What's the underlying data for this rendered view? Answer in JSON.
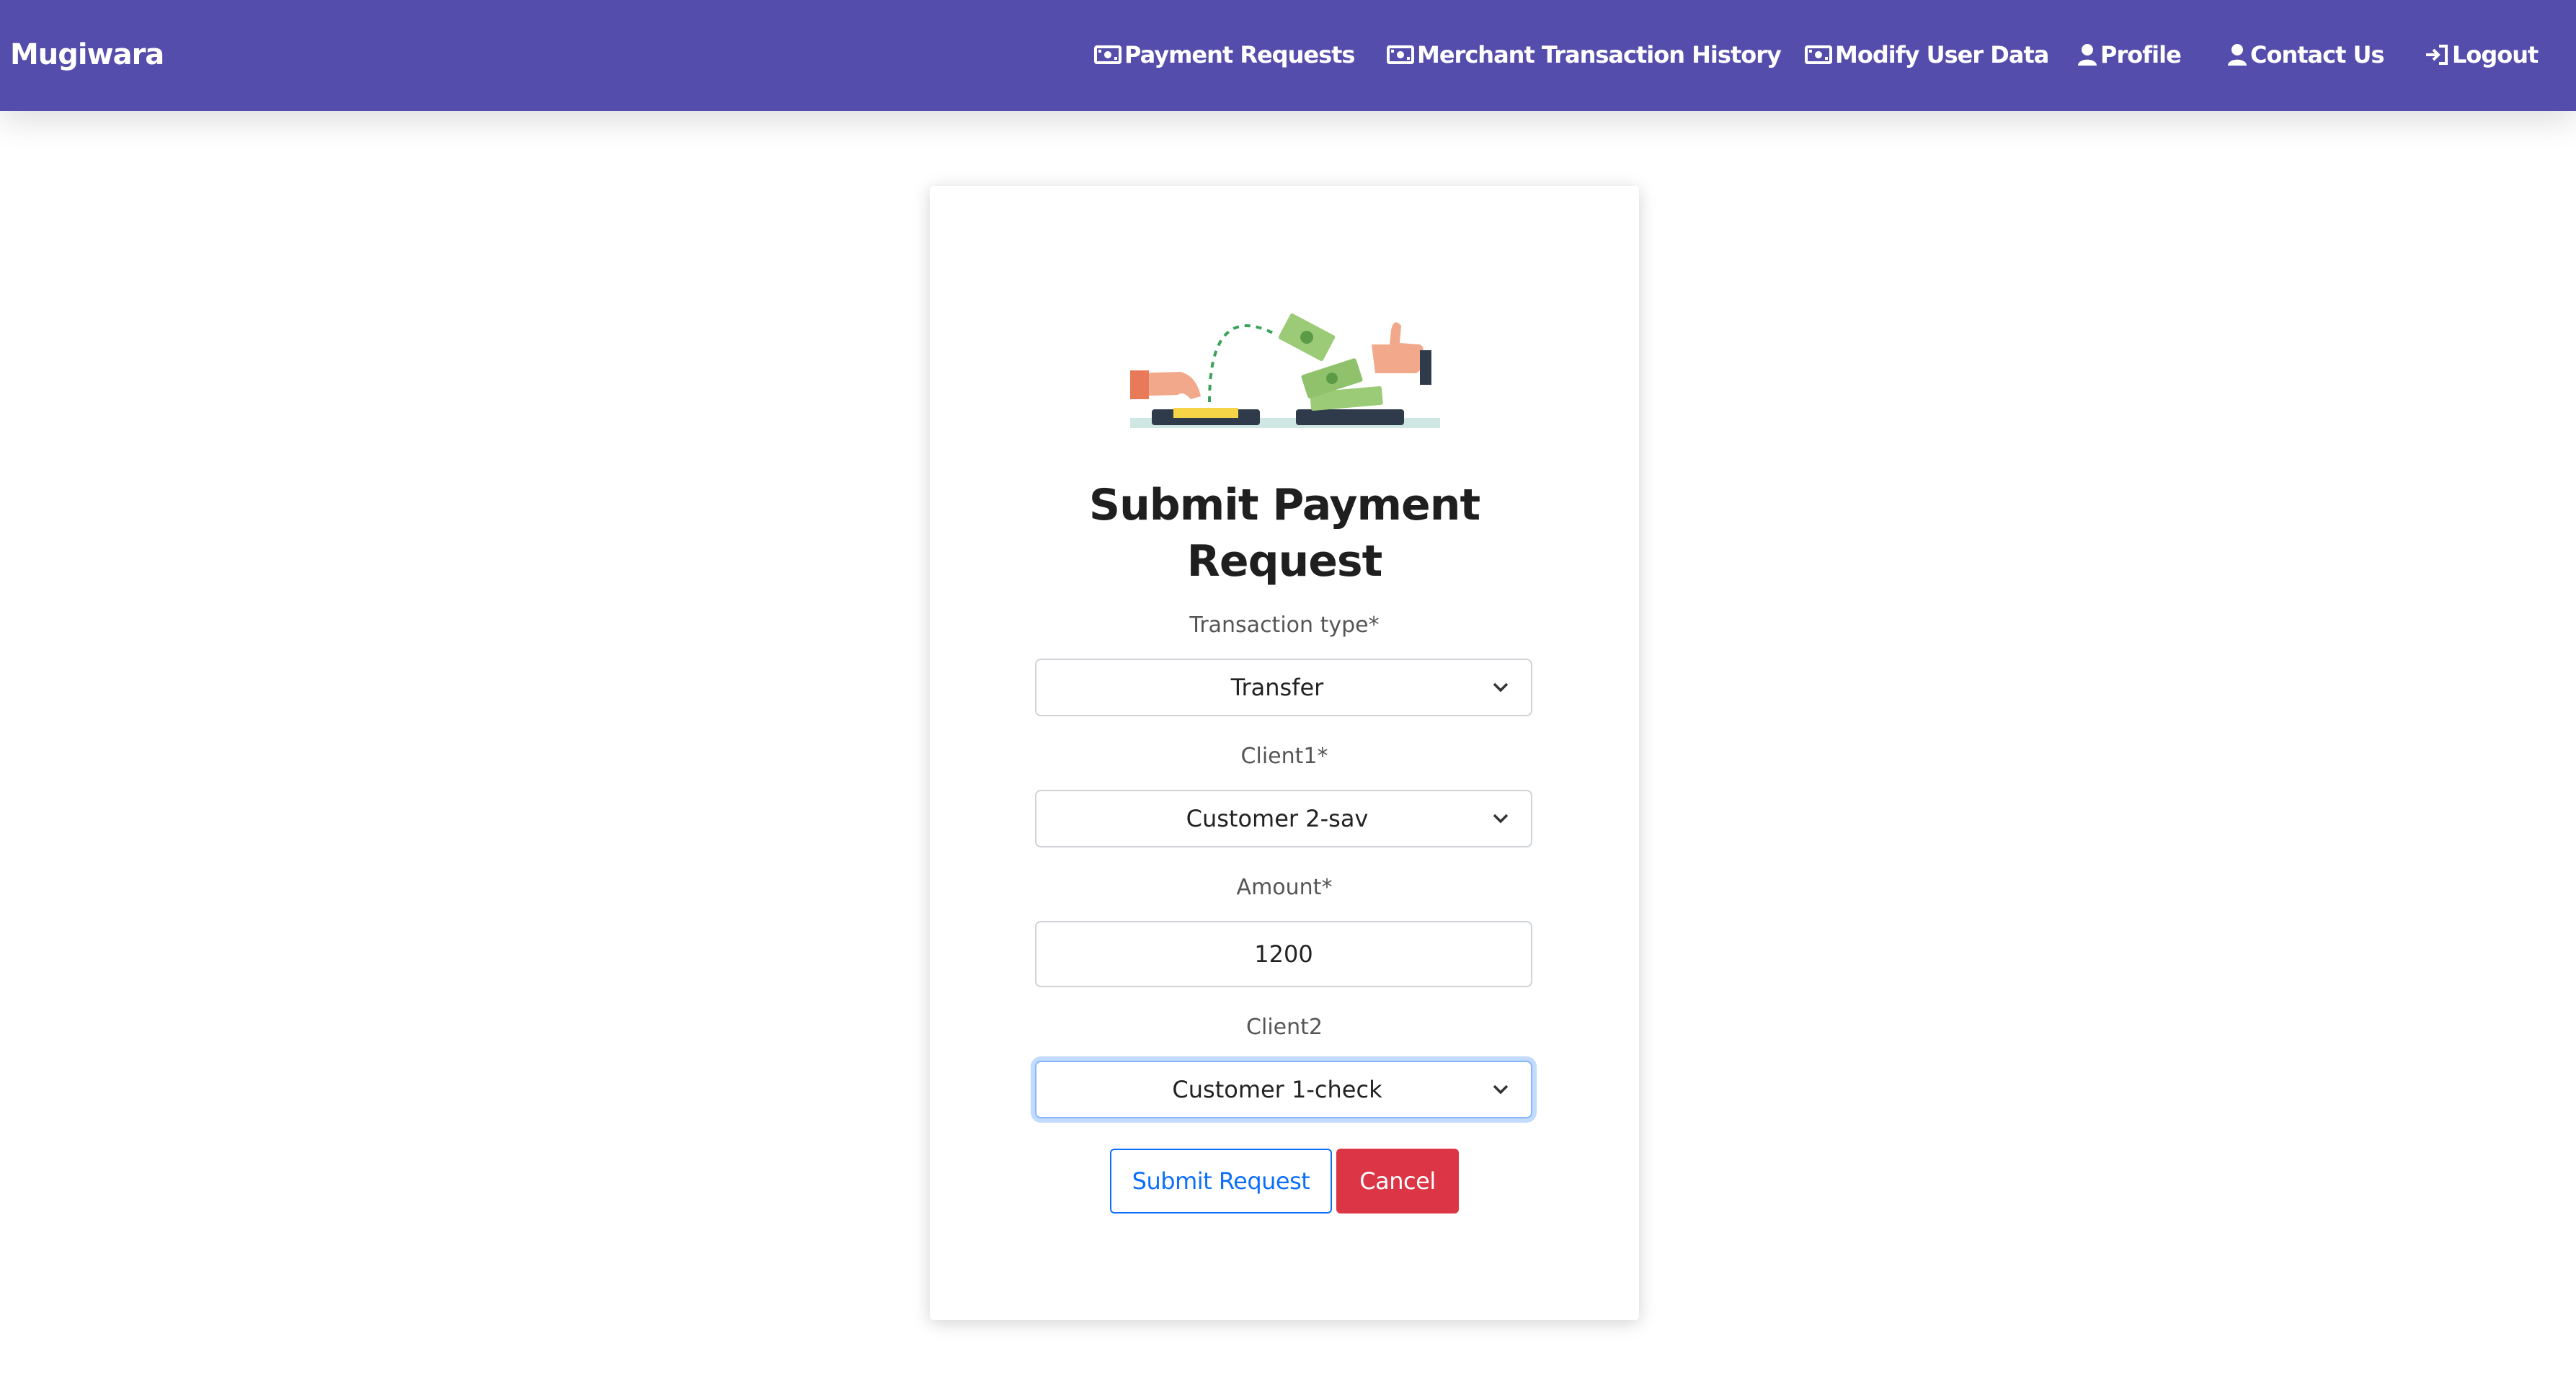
{
  "navbar": {
    "brand": "Mugiwara",
    "items": [
      {
        "label": "Payment Requests",
        "icon": "money-icon"
      },
      {
        "label": "Merchant Transaction History",
        "icon": "money-icon"
      },
      {
        "label": "Modify User Data",
        "icon": "money-icon"
      },
      {
        "label": "Profile",
        "icon": "user-icon"
      },
      {
        "label": "Contact Us",
        "icon": "user-icon"
      },
      {
        "label": "Logout",
        "icon": "sign-in-icon"
      }
    ]
  },
  "form": {
    "title_line1": "Submit Payment",
    "title_line2": "Request",
    "transaction_type": {
      "label": "Transaction type*",
      "value": "Transfer"
    },
    "client1": {
      "label": "Client1*",
      "value": "Customer 2-sav"
    },
    "amount": {
      "label": "Amount*",
      "value": "1200"
    },
    "client2": {
      "label": "Client2",
      "value": "Customer 1-check"
    },
    "submit_label": "Submit Request",
    "cancel_label": "Cancel"
  },
  "colors": {
    "navbar": "#554dab",
    "primary": "#0d6efd",
    "danger": "#dc3545"
  }
}
